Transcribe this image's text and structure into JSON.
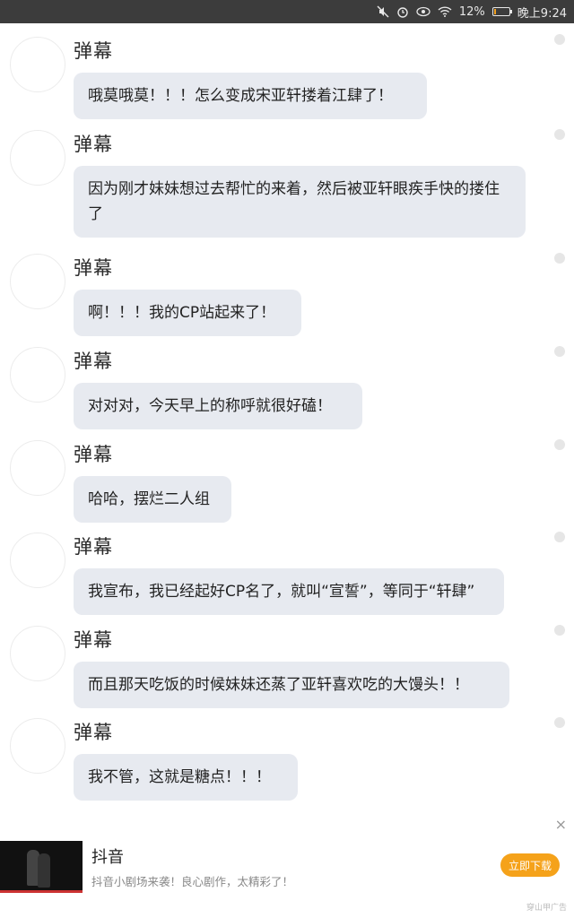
{
  "status_bar": {
    "battery_percent": "12%",
    "battery_level": 0.12,
    "time": "晚上9:24",
    "icons": [
      "mute-icon",
      "alarm-icon",
      "eye-icon",
      "wifi-icon",
      "battery-icon"
    ]
  },
  "messages": [
    {
      "name": "弹幕",
      "text": "哦莫哦莫！！！怎么变成宋亚轩搂着江肆了！"
    },
    {
      "name": "弹幕",
      "text": "因为刚才妹妹想过去帮忙的来着，然后被亚轩眼疾手快的搂住了"
    },
    {
      "name": "弹幕",
      "text": "啊！！！我的CP站起来了！"
    },
    {
      "name": "弹幕",
      "text": "对对对，今天早上的称呼就很好磕！"
    },
    {
      "name": "弹幕",
      "text": "哈哈，摆烂二人组"
    },
    {
      "name": "弹幕",
      "text": "我宣布，我已经起好CP名了，就叫“宣誓”，等同于“轩肆”"
    },
    {
      "name": "弹幕",
      "text": "而且那天吃饭的时候妹妹还蒸了亚轩喜欢吃的大馒头！！"
    },
    {
      "name": "弹幕",
      "text": "我不管，这就是糖点！！！"
    }
  ],
  "ad": {
    "title": "抖音",
    "description": "抖音小剧场来袭！良心剧作，太精彩了！",
    "button_label": "立即下载",
    "source": "穿山甲广告",
    "close_label": "×"
  }
}
